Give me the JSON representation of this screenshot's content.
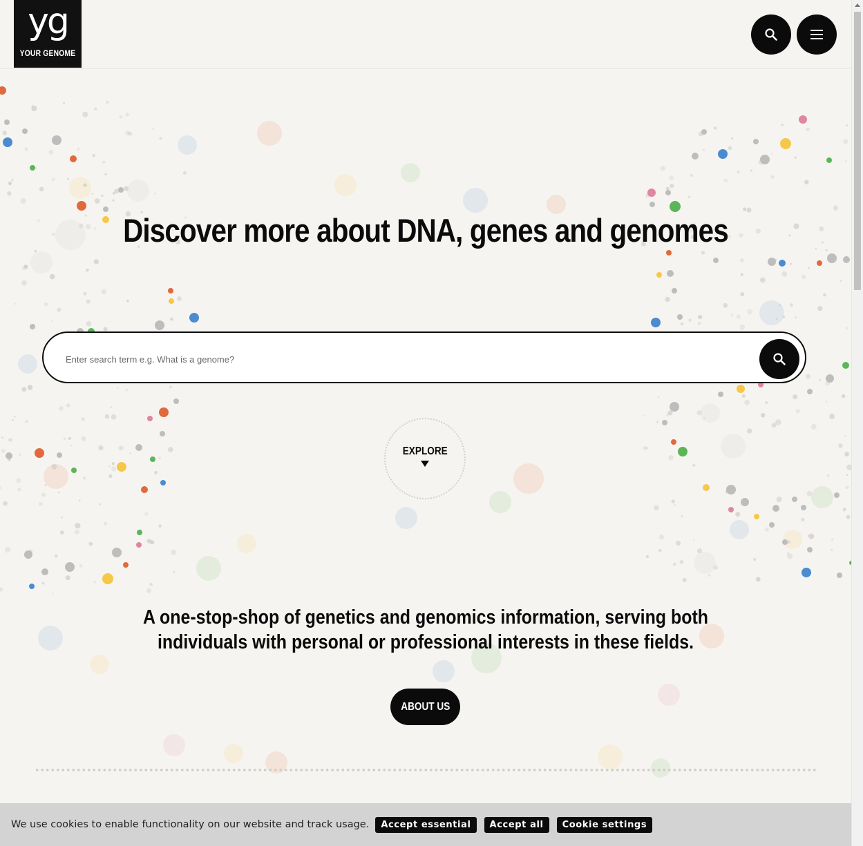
{
  "header": {
    "logo_mark": "yg",
    "logo_text": "YOUR GENOME",
    "search_button_icon": "search-icon",
    "menu_button_icon": "menu-icon"
  },
  "hero": {
    "title": "Discover more about DNA, genes and genomes"
  },
  "search": {
    "placeholder": "Enter search term e.g. What is a genome?",
    "value": "",
    "submit_icon": "search-icon"
  },
  "explore": {
    "label": "EXPLORE",
    "icon": "triangle-down-icon"
  },
  "intro": {
    "tagline": "A one-stop-shop of genetics and genomics information, serving both individuals with personal or professional interests in these fields.",
    "about_button": "ABOUT US"
  },
  "cookie_banner": {
    "message": "We use cookies to enable functionality on our website and track usage.",
    "accept_essential": "Accept essential",
    "accept_all": "Accept all",
    "settings": "Cookie settings"
  },
  "colors": {
    "background": "#f6f4f0",
    "primary": "#0b0b0b",
    "dot_orange": "#e06a3c",
    "dot_blue": "#4a8ccf",
    "dot_green": "#5db55a",
    "dot_yellow": "#f5c84a",
    "dot_pink": "#de86a3",
    "dot_grey": "#bdbdbd"
  }
}
